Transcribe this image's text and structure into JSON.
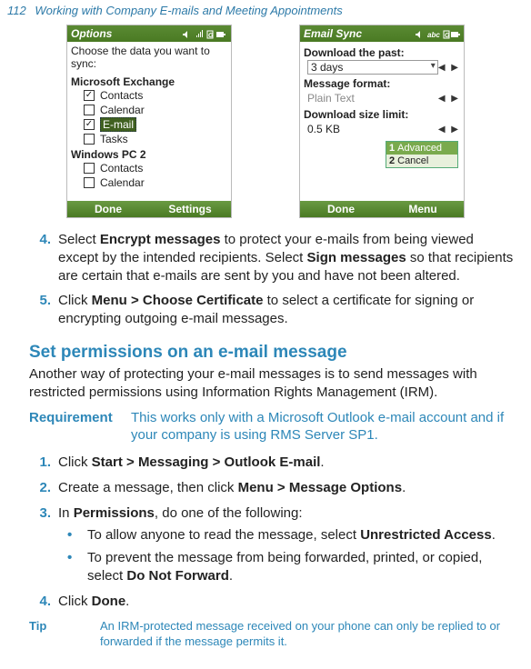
{
  "header": {
    "number": "112",
    "title": "Working with Company E-mails and Meeting Appointments"
  },
  "screenshots": {
    "left": {
      "title": "Options",
      "instruction": "Choose the data you want to sync:",
      "sections": [
        {
          "name": "Microsoft Exchange",
          "items": [
            {
              "label": "Contacts",
              "checked": true
            },
            {
              "label": "Calendar",
              "checked": false
            },
            {
              "label": "E-mail",
              "checked": true,
              "highlight": true
            },
            {
              "label": "Tasks",
              "checked": false
            }
          ]
        },
        {
          "name": "Windows PC 2",
          "items": [
            {
              "label": "Contacts",
              "checked": false
            },
            {
              "label": "Calendar",
              "checked": false
            }
          ]
        }
      ],
      "softkeys": {
        "left": "Done",
        "right": "Settings"
      }
    },
    "right": {
      "title": "Email Sync",
      "fields": [
        {
          "label": "Download the past:",
          "value": "3 days",
          "arrows": "◀  ▶",
          "dropdown": true
        },
        {
          "label": "Message format:",
          "value": "Plain Text",
          "arrows": "◀  ▶",
          "dim": true
        },
        {
          "label": "Download size limit:",
          "value": "0.5 KB",
          "arrows": "◀  ▶"
        }
      ],
      "menu": [
        {
          "num": "1",
          "label": "Advanced",
          "selected": true
        },
        {
          "num": "2",
          "label": "Cancel",
          "selected": false
        }
      ],
      "softkeys": {
        "left": "Done",
        "right": "Menu"
      }
    }
  },
  "step4": {
    "num": "4.",
    "t1": "Select ",
    "b1": "Encrypt messages",
    "t2": " to protect your e-mails from being viewed except by the intended recipients. Select ",
    "b2": "Sign messages",
    "t3": " so that recipients are certain that e-mails are sent by you and have not been altered."
  },
  "step5": {
    "num": "5.",
    "t1": "Click ",
    "b1": "Menu > Choose Certificate",
    "t2": " to select a certificate for signing or encrypting outgoing e-mail messages."
  },
  "section2": {
    "heading": "Set permissions on an e-mail message",
    "para": "Another way of protecting your e-mail messages is to send messages with restricted permissions using Information Rights Management (IRM).",
    "requirement": {
      "key": "Requirement",
      "val": "This works only with a Microsoft Outlook e-mail account and if your company is using RMS Server SP1."
    },
    "s1": {
      "num": "1.",
      "t1": "Click ",
      "b1": "Start > Messaging > Outlook E-mail",
      "t2": "."
    },
    "s2": {
      "num": "2.",
      "t1": "Create a message, then click ",
      "b1": "Menu > Message Options",
      "t2": "."
    },
    "s3": {
      "num": "3.",
      "t1": "In ",
      "b1": "Permissions",
      "t2": ", do one of the following:"
    },
    "bul1": {
      "t1": "To allow anyone to read the message, select ",
      "b1": "Unrestricted Access",
      "t2": "."
    },
    "bul2": {
      "t1": "To prevent the message from being forwarded, printed, or copied, select ",
      "b1": "Do Not Forward",
      "t2": "."
    },
    "s4": {
      "num": "4.",
      "t1": "Click ",
      "b1": "Done",
      "t2": "."
    },
    "tip": {
      "key": "Tip",
      "val": "An IRM-protected message received on your phone can only be replied to or forwarded if the message permits it."
    }
  }
}
